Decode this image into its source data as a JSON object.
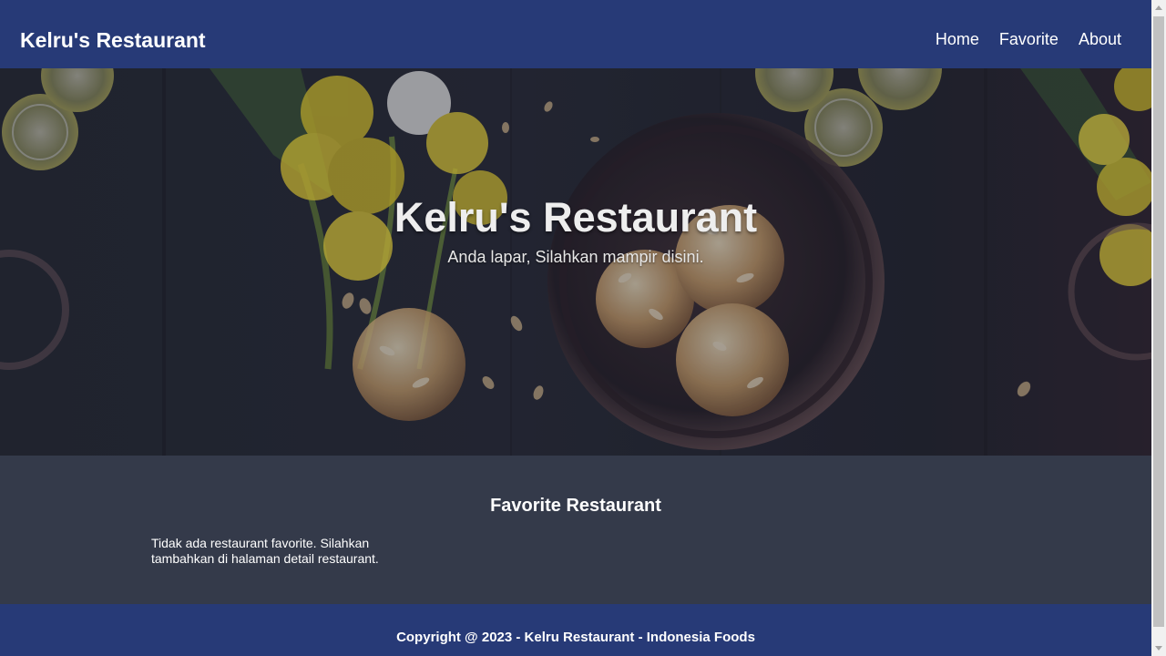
{
  "app": {
    "brand": "Kelru's Restaurant"
  },
  "nav": {
    "items": [
      {
        "label": "Home"
      },
      {
        "label": "Favorite"
      },
      {
        "label": "About"
      }
    ]
  },
  "hero": {
    "title": "Kelru's Restaurant",
    "subtitle": "Anda lapar, Silahkan mampir disini."
  },
  "favorite": {
    "title": "Favorite Restaurant",
    "empty_message": "Tidak ada restaurant favorite. Silahkan tambahkan di halaman detail restaurant."
  },
  "footer": {
    "copyright": "Copyright @ 2023 - Kelru Restaurant - Indonesia Foods"
  },
  "colors": {
    "navbar": "#273a77",
    "content_background": "#343a4a",
    "text": "#ffffff",
    "flower": "#e4cf36",
    "lemon": "#d5d890",
    "cookie": "#c99863"
  },
  "icons": {
    "scroll_up": "chevron-up-icon",
    "scroll_down": "chevron-down-icon"
  }
}
